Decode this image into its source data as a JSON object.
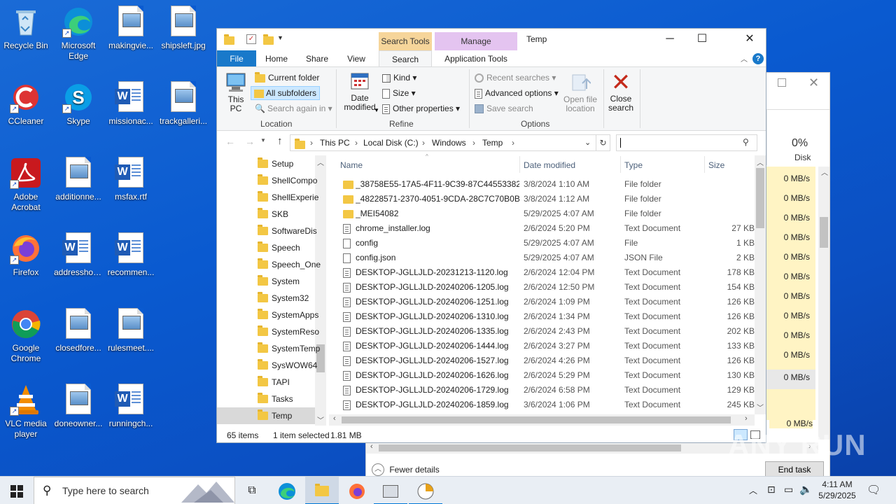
{
  "desktop": {
    "icons": [
      {
        "label": "Recycle Bin"
      },
      {
        "label": "Microsoft Edge"
      },
      {
        "label": "makingvie..."
      },
      {
        "label": "shipsleft.jpg"
      },
      {
        "label": "CCleaner"
      },
      {
        "label": "Skype"
      },
      {
        "label": "missionac..."
      },
      {
        "label": "trackgalleri..."
      },
      {
        "label": "Adobe Acrobat"
      },
      {
        "label": "additionne..."
      },
      {
        "label": "msfax.rtf"
      },
      {
        "label": "Firefox"
      },
      {
        "label": "addresshou..."
      },
      {
        "label": "recommen..."
      },
      {
        "label": "Google Chrome"
      },
      {
        "label": "closedfore..."
      },
      {
        "label": "rulesmeet...."
      },
      {
        "label": "VLC media player"
      },
      {
        "label": "doneowner..."
      },
      {
        "label": "runningch..."
      }
    ],
    "watermark": "ANY RUN"
  },
  "explorer": {
    "title": "Temp",
    "context_tabs": {
      "search_tools": "Search Tools",
      "manage": "Manage"
    },
    "tabs": [
      "File",
      "Home",
      "Share",
      "View",
      "Search",
      "Application Tools"
    ],
    "ribbon": {
      "this_pc": "This PC",
      "current_folder": "Current folder",
      "all_subfolders": "All subfolders",
      "search_again_in": "Search again in",
      "location_group": "Location",
      "date_modified": "Date modified",
      "kind": "Kind",
      "size": "Size",
      "other_properties": "Other properties",
      "refine_group": "Refine",
      "recent_searches": "Recent searches",
      "advanced_options": "Advanced options",
      "save_search": "Save search",
      "options_group": "Options",
      "open_file_location": "Open file location",
      "close_search": "Close search"
    },
    "address": [
      "This PC",
      "Local Disk (C:)",
      "Windows",
      "Temp"
    ],
    "nav_items": [
      "Setup",
      "ShellCompo",
      "ShellExperie",
      "SKB",
      "SoftwareDis",
      "Speech",
      "Speech_One",
      "System",
      "System32",
      "SystemApps",
      "SystemReso",
      "SystemTemp",
      "SysWOW64",
      "TAPI",
      "Tasks",
      "Temp"
    ],
    "columns": {
      "name": "Name",
      "date": "Date modified",
      "type": "Type",
      "size": "Size"
    },
    "files": [
      {
        "name": "_38758E55-17A5-4F11-9C39-87C445533821",
        "date": "3/8/2024 1:10 AM",
        "type": "File folder",
        "size": "",
        "icon": "folder"
      },
      {
        "name": "_48228571-2370-4051-9CDA-28C7C70B0B...",
        "date": "3/8/2024 1:12 AM",
        "type": "File folder",
        "size": "",
        "icon": "folder"
      },
      {
        "name": "_MEI54082",
        "date": "5/29/2025 4:07 AM",
        "type": "File folder",
        "size": "",
        "icon": "folder"
      },
      {
        "name": "chrome_installer.log",
        "date": "2/6/2024 5:20 PM",
        "type": "Text Document",
        "size": "27 KB",
        "icon": "text"
      },
      {
        "name": "config",
        "date": "5/29/2025 4:07 AM",
        "type": "File",
        "size": "1 KB",
        "icon": "file"
      },
      {
        "name": "config.json",
        "date": "5/29/2025 4:07 AM",
        "type": "JSON File",
        "size": "2 KB",
        "icon": "file"
      },
      {
        "name": "DESKTOP-JGLLJLD-20231213-1120.log",
        "date": "2/6/2024 12:04 PM",
        "type": "Text Document",
        "size": "178 KB",
        "icon": "text"
      },
      {
        "name": "DESKTOP-JGLLJLD-20240206-1205.log",
        "date": "2/6/2024 12:50 PM",
        "type": "Text Document",
        "size": "154 KB",
        "icon": "text"
      },
      {
        "name": "DESKTOP-JGLLJLD-20240206-1251.log",
        "date": "2/6/2024 1:09 PM",
        "type": "Text Document",
        "size": "126 KB",
        "icon": "text"
      },
      {
        "name": "DESKTOP-JGLLJLD-20240206-1310.log",
        "date": "2/6/2024 1:34 PM",
        "type": "Text Document",
        "size": "126 KB",
        "icon": "text"
      },
      {
        "name": "DESKTOP-JGLLJLD-20240206-1335.log",
        "date": "2/6/2024 2:43 PM",
        "type": "Text Document",
        "size": "202 KB",
        "icon": "text"
      },
      {
        "name": "DESKTOP-JGLLJLD-20240206-1444.log",
        "date": "2/6/2024 3:27 PM",
        "type": "Text Document",
        "size": "133 KB",
        "icon": "text"
      },
      {
        "name": "DESKTOP-JGLLJLD-20240206-1527.log",
        "date": "2/6/2024 4:26 PM",
        "type": "Text Document",
        "size": "126 KB",
        "icon": "text"
      },
      {
        "name": "DESKTOP-JGLLJLD-20240206-1626.log",
        "date": "2/6/2024 5:29 PM",
        "type": "Text Document",
        "size": "130 KB",
        "icon": "text"
      },
      {
        "name": "DESKTOP-JGLLJLD-20240206-1729.log",
        "date": "2/6/2024 6:58 PM",
        "type": "Text Document",
        "size": "129 KB",
        "icon": "text"
      },
      {
        "name": "DESKTOP-JGLLJLD-20240206-1859.log",
        "date": "3/6/2024 1:06 PM",
        "type": "Text Document",
        "size": "245 KB",
        "icon": "text"
      }
    ],
    "status": {
      "items": "65 items",
      "selected": "1 item selected",
      "size": "1.81 MB"
    }
  },
  "task_manager": {
    "disk_pct": "0%",
    "disk_label": "Disk",
    "disk_values": [
      "0 MB/s",
      "0 MB/s",
      "0 MB/s",
      "0 MB/s",
      "0 MB/s",
      "0 MB/s",
      "0 MB/s",
      "0 MB/s",
      "0 MB/s",
      "0 MB/s",
      "0 MB/s"
    ],
    "bottom_value": "0 MB/s",
    "fewer_details": "Fewer details",
    "end_task": "End task"
  },
  "taskbar": {
    "search_placeholder": "Type here to search",
    "time": "4:11 AM",
    "date": "5/29/2025"
  },
  "colors": {
    "accent": "#0078d7",
    "search_tools": "#f6d59a",
    "manage": "#e4c4f0",
    "desktop": "#0b56cc"
  }
}
